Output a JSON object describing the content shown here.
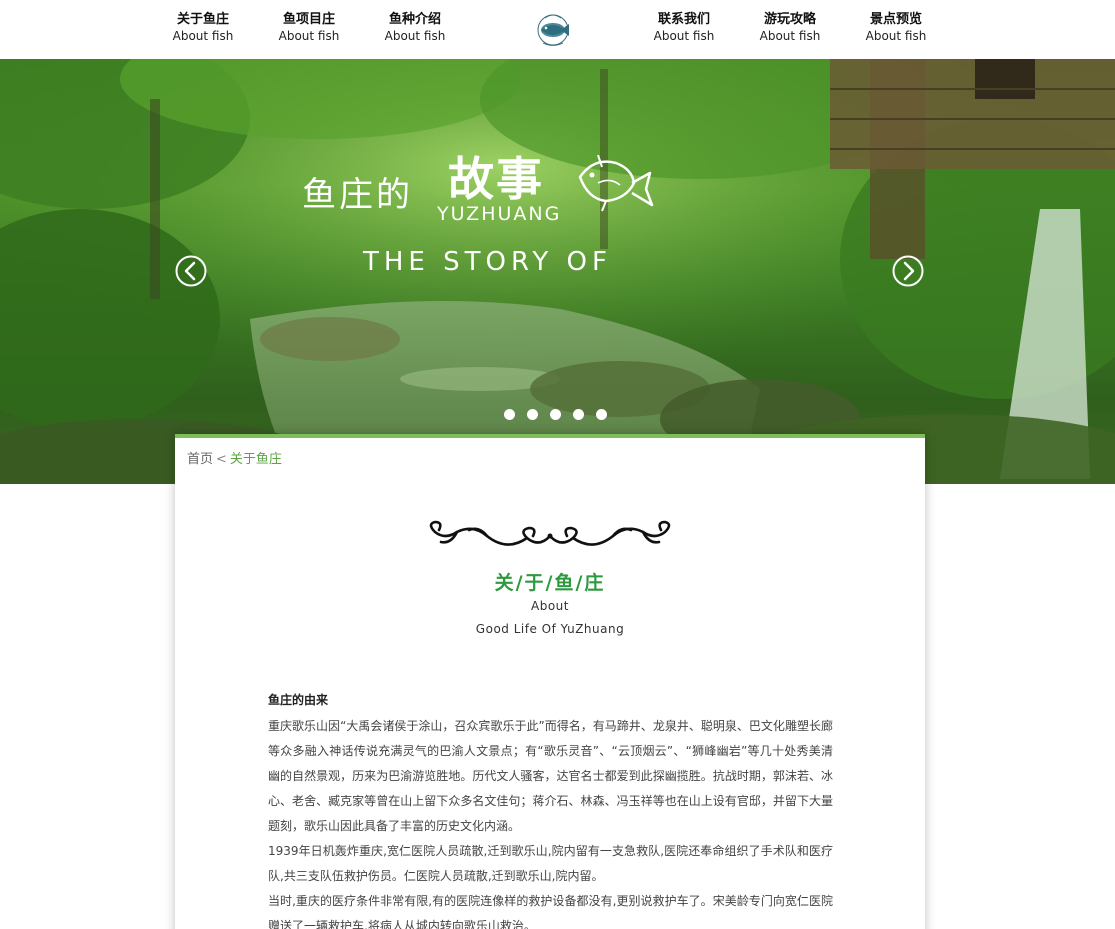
{
  "nav": {
    "left_items": [
      {
        "cn": "关于鱼庄",
        "en": "About fish"
      },
      {
        "cn": "鱼项目庄",
        "en": "About fish"
      },
      {
        "cn": "鱼种介绍",
        "en": "About fish"
      }
    ],
    "right_items": [
      {
        "cn": "联系我们",
        "en": "About fish"
      },
      {
        "cn": "游玩攻略",
        "en": "About fish"
      },
      {
        "cn": "景点预览",
        "en": "About fish"
      }
    ]
  },
  "hero": {
    "title_small": "鱼庄的",
    "title_big": "故事",
    "pinyin": "YUZHUANG",
    "story": "THE STORY OF",
    "slide_count": 5
  },
  "breadcrumb": {
    "home": "首页",
    "separator": "<",
    "current": "关于鱼庄"
  },
  "section": {
    "title": "关/于/鱼/庄",
    "subtitle_en": "About",
    "subtitle_en2": "Good Life Of YuZhuang"
  },
  "article": {
    "heading": "鱼庄的由来",
    "paragraphs": [
      "重庆歌乐山因“大禹会诸侯于涂山，召众宾歌乐于此”而得名，有马蹄井、龙泉井、聪明泉、巴文化雕塑长廊等众多融入神话传说充满灵气的巴渝人文景点；有“歌乐灵音”、“云顶烟云”、“狮峰幽岩”等几十处秀美清幽的自然景观，历来为巴渝游览胜地。历代文人骚客，达官名士都爱到此探幽揽胜。抗战时期，郭沫若、冰心、老舍、臧克家等曾在山上留下众多名文佳句；蒋介石、林森、冯玉祥等也在山上设有官邸，并留下大量题刻，歌乐山因此具备了丰富的历史文化内涵。",
      "1939年日机轰炸重庆,宽仁医院人员疏散,迁到歌乐山,院内留有一支急救队,医院还奉命组织了手术队和医疗队,共三支队伍救护伤员。仁医院人员疏散,迁到歌乐山,院内留。",
      "当时,重庆的医疗条件非常有限,有的医院连像样的救护设备都没有,更别说救护车了。宋美龄专门向宽仁医院赠送了一辆救护车,将病人从城内转向歌乐山救治。"
    ]
  },
  "colors": {
    "accent_green": "#2e9a3f",
    "breadcrumb_green": "#5aa542",
    "card_border": "#7cbf5a"
  }
}
